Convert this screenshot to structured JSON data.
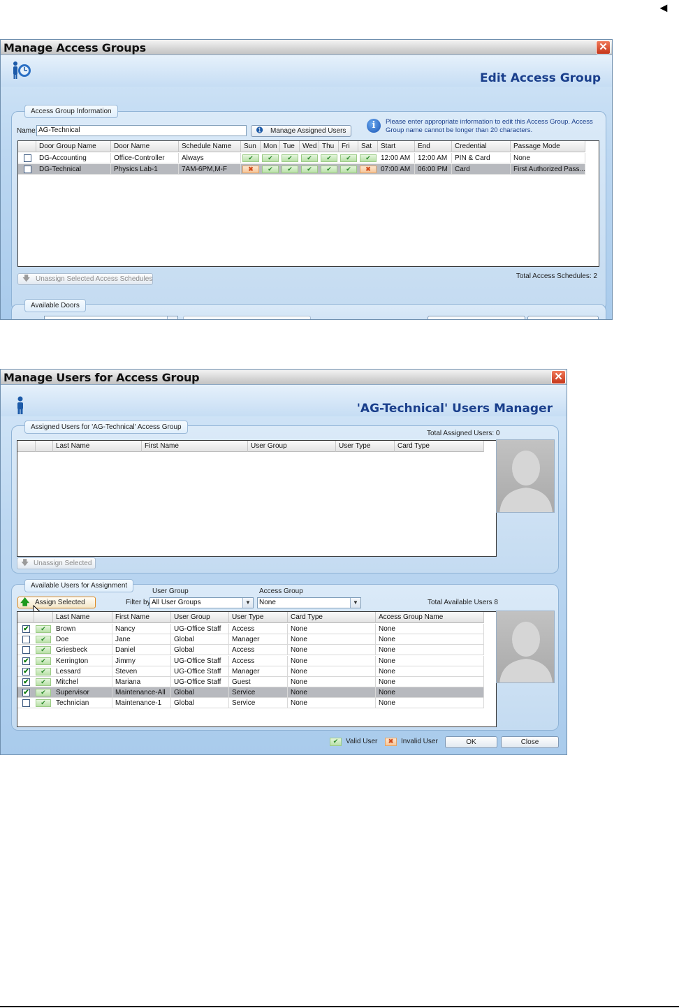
{
  "page": {
    "back_arrow": "◄"
  },
  "win1": {
    "title": "Manage Access Groups",
    "close": "✕",
    "heading": "Edit Access Group",
    "info_legend": "Access Group Information",
    "name_label": "Name:",
    "name_value": "AG-Technical",
    "manage_users_btn": "Manage Assigned Users",
    "info_text": "Please enter appropriate information to edit this Access Group. Access Group name cannot be longer than 20 characters.",
    "columns": [
      "Door Group Name",
      "Door Name",
      "Schedule Name",
      "Sun",
      "Mon",
      "Tue",
      "Wed",
      "Thu",
      "Fri",
      "Sat",
      "Start",
      "End",
      "Credential",
      "Passage Mode"
    ],
    "rows": [
      {
        "group": "DG-Accounting",
        "door": "Office-Controller",
        "schedule": "Always",
        "days": [
          true,
          true,
          true,
          true,
          true,
          true,
          true
        ],
        "start": "12:00 AM",
        "end": "12:00 AM",
        "credential": "PIN & Card",
        "mode": "None",
        "checked": false,
        "selected": false
      },
      {
        "group": "DG-Technical",
        "door": "Physics Lab-1",
        "schedule": "7AM-6PM,M-F",
        "days": [
          false,
          true,
          true,
          true,
          true,
          true,
          false
        ],
        "start": "07:00 AM",
        "end": "06:00 PM",
        "credential": "Card",
        "mode": "First Authorized Pass...",
        "checked": false,
        "selected": true
      }
    ],
    "unassign_btn": "Unassign Selected Access Schedules",
    "total_schedules": "Total Access Schedules: 2",
    "doors_legend": "Available Doors"
  },
  "win2": {
    "title": "Manage Users for Access Group",
    "close": "✕",
    "heading": "'AG-Technical' Users Manager",
    "assigned_legend": "Assigned Users for 'AG-Technical' Access Group",
    "total_assigned": "Total Assigned Users: 0",
    "assigned_columns": [
      "Last Name",
      "First Name",
      "User Group",
      "User Type",
      "Card Type"
    ],
    "unassign_btn": "Unassign Selected",
    "available_legend": "Available Users for Assignment",
    "assign_btn": "Assign Selected",
    "user_group_label": "User Group",
    "filter_label": "Filter by:",
    "user_group_value": "All User Groups",
    "access_group_label": "Access Group",
    "access_group_value": "None",
    "total_available": "Total Available Users 8",
    "available_columns": [
      "Last Name",
      "First Name",
      "User Group",
      "User Type",
      "Card Type",
      "Access Group Name"
    ],
    "users": [
      {
        "last": "Brown",
        "first": "Nancy",
        "group": "UG-Office Staff",
        "type": "Access",
        "card": "None",
        "ag": "None",
        "checked": true,
        "selected": false
      },
      {
        "last": "Doe",
        "first": "Jane",
        "group": "Global",
        "type": "Manager",
        "card": "None",
        "ag": "None",
        "checked": false,
        "selected": false
      },
      {
        "last": "Griesbeck",
        "first": "Daniel",
        "group": "Global",
        "type": "Access",
        "card": "None",
        "ag": "None",
        "checked": false,
        "selected": false
      },
      {
        "last": "Kerrington",
        "first": "Jimmy",
        "group": "UG-Office Staff",
        "type": "Access",
        "card": "None",
        "ag": "None",
        "checked": true,
        "selected": false
      },
      {
        "last": "Lessard",
        "first": "Steven",
        "group": "UG-Office Staff",
        "type": "Manager",
        "card": "None",
        "ag": "None",
        "checked": true,
        "selected": false
      },
      {
        "last": "Mitchel",
        "first": "Mariana",
        "group": "UG-Office Staff",
        "type": "Guest",
        "card": "None",
        "ag": "None",
        "checked": true,
        "selected": false
      },
      {
        "last": "Supervisor",
        "first": "Maintenance-All",
        "group": "Global",
        "type": "Service",
        "card": "None",
        "ag": "None",
        "checked": true,
        "selected": true
      },
      {
        "last": "Technician",
        "first": "Maintenance-1",
        "group": "Global",
        "type": "Service",
        "card": "None",
        "ag": "None",
        "checked": false,
        "selected": false
      }
    ],
    "valid_label": "Valid User",
    "invalid_label": "Invalid User",
    "ok_btn": "OK",
    "close_btn": "Close"
  }
}
